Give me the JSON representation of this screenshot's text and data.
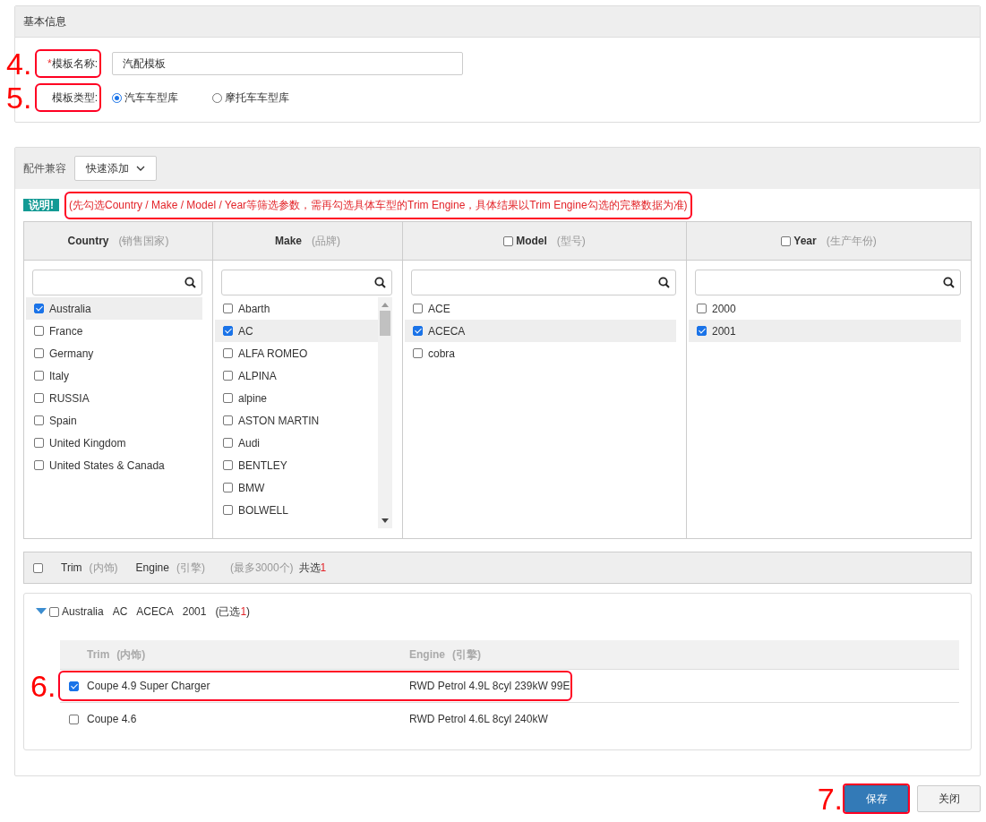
{
  "basic_info": {
    "title": "基本信息",
    "name_field": {
      "required_mark": "*",
      "label": "模板名称:",
      "value": "汽配模板",
      "annotation": "4."
    },
    "type_field": {
      "label": "模板类型:",
      "annotation": "5.",
      "options": [
        {
          "label": "汽车车型库",
          "selected": true
        },
        {
          "label": "摩托车车型库",
          "selected": false
        }
      ]
    }
  },
  "compat": {
    "title": "配件兼容",
    "quick_add": "快速添加",
    "note": {
      "badge": "说明!",
      "text": "(先勾选Country / Make / Model / Year等筛选参数，需再勾选具体车型的Trim Engine，具体结果以Trim Engine勾选的完整数据为准)",
      "highlighted": true
    },
    "filters": [
      {
        "kind": "plain",
        "title": "Country",
        "subtitle": "(销售国家)",
        "scrollable": false,
        "items": [
          {
            "label": "Australia",
            "checked": true
          },
          {
            "label": "France",
            "checked": false
          },
          {
            "label": "Germany",
            "checked": false
          },
          {
            "label": "Italy",
            "checked": false
          },
          {
            "label": "RUSSIA",
            "checked": false
          },
          {
            "label": "Spain",
            "checked": false
          },
          {
            "label": "United Kingdom",
            "checked": false
          },
          {
            "label": "United States & Canada",
            "checked": false
          }
        ]
      },
      {
        "kind": "plain",
        "title": "Make",
        "subtitle": "(品牌)",
        "scrollable": true,
        "items": [
          {
            "label": "Abarth",
            "checked": false
          },
          {
            "label": "AC",
            "checked": true
          },
          {
            "label": "ALFA ROMEO",
            "checked": false
          },
          {
            "label": "ALPINA",
            "checked": false
          },
          {
            "label": "alpine",
            "checked": false
          },
          {
            "label": "ASTON MARTIN",
            "checked": false
          },
          {
            "label": "Audi",
            "checked": false
          },
          {
            "label": "BENTLEY",
            "checked": false
          },
          {
            "label": "BMW",
            "checked": false
          },
          {
            "label": "BOLWELL",
            "checked": false
          }
        ]
      },
      {
        "kind": "checkbox",
        "checked": false,
        "title": "Model",
        "subtitle": "(型号)",
        "scrollable": false,
        "items": [
          {
            "label": "ACE",
            "checked": false
          },
          {
            "label": "ACECA",
            "checked": true
          },
          {
            "label": "cobra",
            "checked": false
          }
        ]
      },
      {
        "kind": "checkbox",
        "checked": false,
        "title": "Year",
        "subtitle": "(生产年份)",
        "scrollable": false,
        "items": [
          {
            "label": "2000",
            "checked": false
          },
          {
            "label": "2001",
            "checked": true
          }
        ]
      }
    ],
    "trim_bar": {
      "checked": false,
      "trim": "Trim",
      "trim_sub": "(内饰)",
      "engine": "Engine",
      "engine_sub": "(引擎)",
      "limit": "(最多3000个)",
      "total_label": "共选",
      "total": "1"
    },
    "groups": [
      {
        "expanded": true,
        "checked": false,
        "path": [
          "Australia",
          "AC",
          "ACECA",
          "2001"
        ],
        "selected_label": "(已选",
        "selected_count": "1",
        "selected_close": ")",
        "columns": [
          {
            "title": "Trim",
            "sub": "(内饰)"
          },
          {
            "title": "Engine",
            "sub": "(引擎)"
          }
        ],
        "rows": [
          {
            "checked": true,
            "trim": "Coupe 4.9 Super Charger",
            "engine": "RWD Petrol 4.9L 8cyl 239kW 99E",
            "annotation": "6."
          },
          {
            "checked": false,
            "trim": "Coupe 4.6",
            "engine": "RWD Petrol 4.6L 8cyl 240kW"
          }
        ]
      }
    ]
  },
  "buttons": [
    {
      "kind": "primary",
      "label": "保存",
      "annotation": "7."
    },
    {
      "kind": "default",
      "label": "关闭"
    }
  ]
}
